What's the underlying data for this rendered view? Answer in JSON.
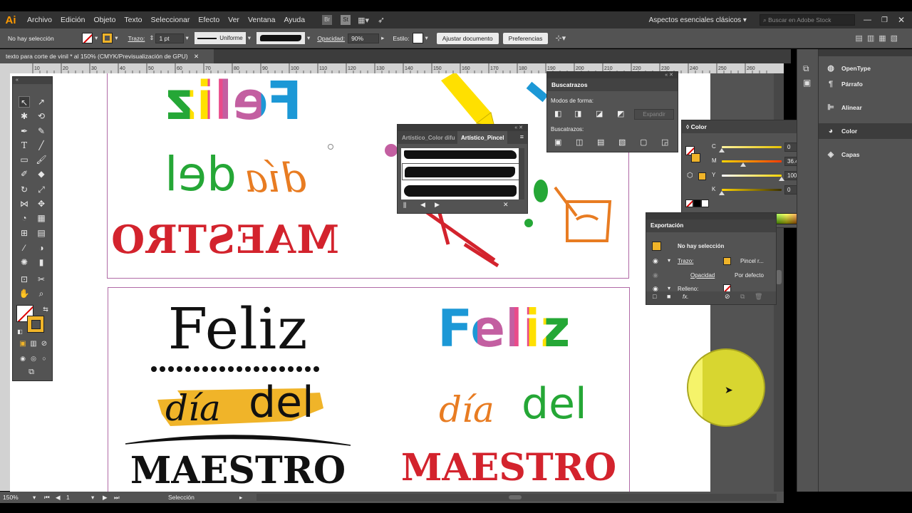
{
  "app": {
    "logo": "Ai"
  },
  "menu": [
    "Archivo",
    "Edición",
    "Objeto",
    "Texto",
    "Seleccionar",
    "Efecto",
    "Ver",
    "Ventana",
    "Ayuda"
  ],
  "workspace": {
    "name": "Aspectos esenciales clásicos",
    "search_placeholder": "Buscar en Adobe Stock"
  },
  "control_bar": {
    "selection": "No hay selección",
    "stroke_label": "Trazo:",
    "stroke_weight": "1 pt",
    "stroke_profile": "Uniforme",
    "opacity_label": "Opacidad:",
    "opacity_value": "90%",
    "style_label": "Estilo:",
    "adjust_btn": "Ajustar documento",
    "prefs_btn": "Preferencias"
  },
  "document_tab": "texto para corte de vinil * al 150% (CMYK/Previsualización de GPU)",
  "ruler_ticks": [
    "10",
    "20",
    "30",
    "40",
    "50",
    "60",
    "70",
    "80",
    "90",
    "100",
    "110",
    "120",
    "130",
    "140",
    "150",
    "160",
    "170",
    "180",
    "190",
    "200",
    "210",
    "220",
    "230",
    "240",
    "250",
    "260"
  ],
  "artwork": {
    "top_feliz": "Feliz",
    "top_dia": "día",
    "top_del": "del",
    "top_maestro": "MAESTRO",
    "bl_feliz": "Feliz",
    "bl_dia": "día",
    "bl_del": "del",
    "bl_maestro": "MAESTRO",
    "br_feliz": "Feliz",
    "br_dia": "día",
    "br_del": "del",
    "br_maestro": "MAESTRO"
  },
  "colors": {
    "blue": "#1c98d6",
    "green": "#25a736",
    "yellow": "#ffe000",
    "pink": "#c35fa1",
    "orange": "#e87c22",
    "red": "#d3232d",
    "stroke_gold": "#f0b429",
    "frame": "#b06aa6"
  },
  "buscatrazos": {
    "title": "Buscatrazos",
    "modes_label": "Modos de forma:",
    "expand_btn": "Expandir",
    "finders_label": "Buscatrazos:"
  },
  "brush_panel": {
    "tab1": "Artístico_Color difu",
    "tab2": "Artístico_Pincel"
  },
  "color_panel": {
    "title": "Color",
    "channels": [
      {
        "label": "C",
        "value": "0",
        "pct": "%",
        "pos": 0.0
      },
      {
        "label": "M",
        "value": "36.47",
        "pct": "%",
        "pos": 0.36
      },
      {
        "label": "Y",
        "value": "100",
        "pct": "%",
        "pos": 1.0
      },
      {
        "label": "K",
        "value": "0",
        "pct": "%",
        "pos": 0.0
      }
    ]
  },
  "appearance_panel": {
    "title": "Exportación",
    "selection": "No hay selección",
    "stroke_label": "Trazo:",
    "stroke_value": "Pincel r...",
    "opacity_label": "Opacidad",
    "opacity_value": "Por defecto",
    "fill_label": "Relleno:",
    "fx": "fx."
  },
  "dock": [
    "OpenType",
    "Párrafo",
    "Alinear",
    "Color",
    "Capas"
  ],
  "status": {
    "zoom": "150%",
    "page": "1",
    "mode": "Selección"
  }
}
